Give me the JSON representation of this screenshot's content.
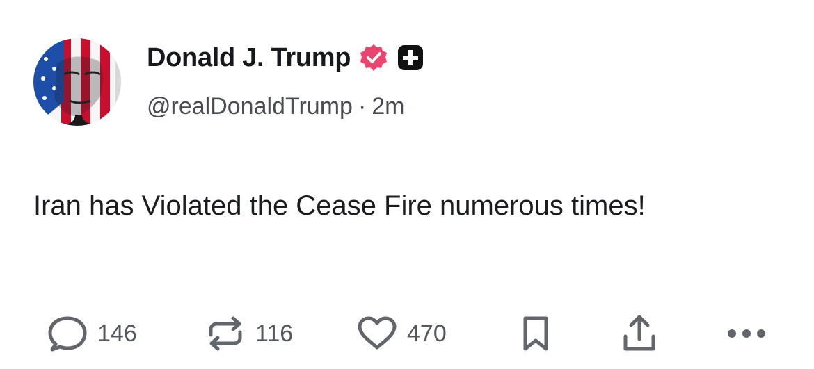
{
  "author": {
    "display_name": "Donald J. Trump",
    "handle": "@realDonaldTrump",
    "separator": "·",
    "time_ago": "2m",
    "verified_badge_color": "#e8466e",
    "plus_badge_color": "#111111"
  },
  "post": {
    "text": "Iran has Violated the Cease Fire numerous times!"
  },
  "actions": {
    "replies_count": "146",
    "retruths_count": "116",
    "likes_count": "470",
    "icons": [
      "speech-bubble-icon",
      "repost-arrows-icon",
      "heart-icon",
      "bookmark-icon",
      "share-upload-icon",
      "more-dots-icon"
    ],
    "icon_color": "#63656c"
  }
}
